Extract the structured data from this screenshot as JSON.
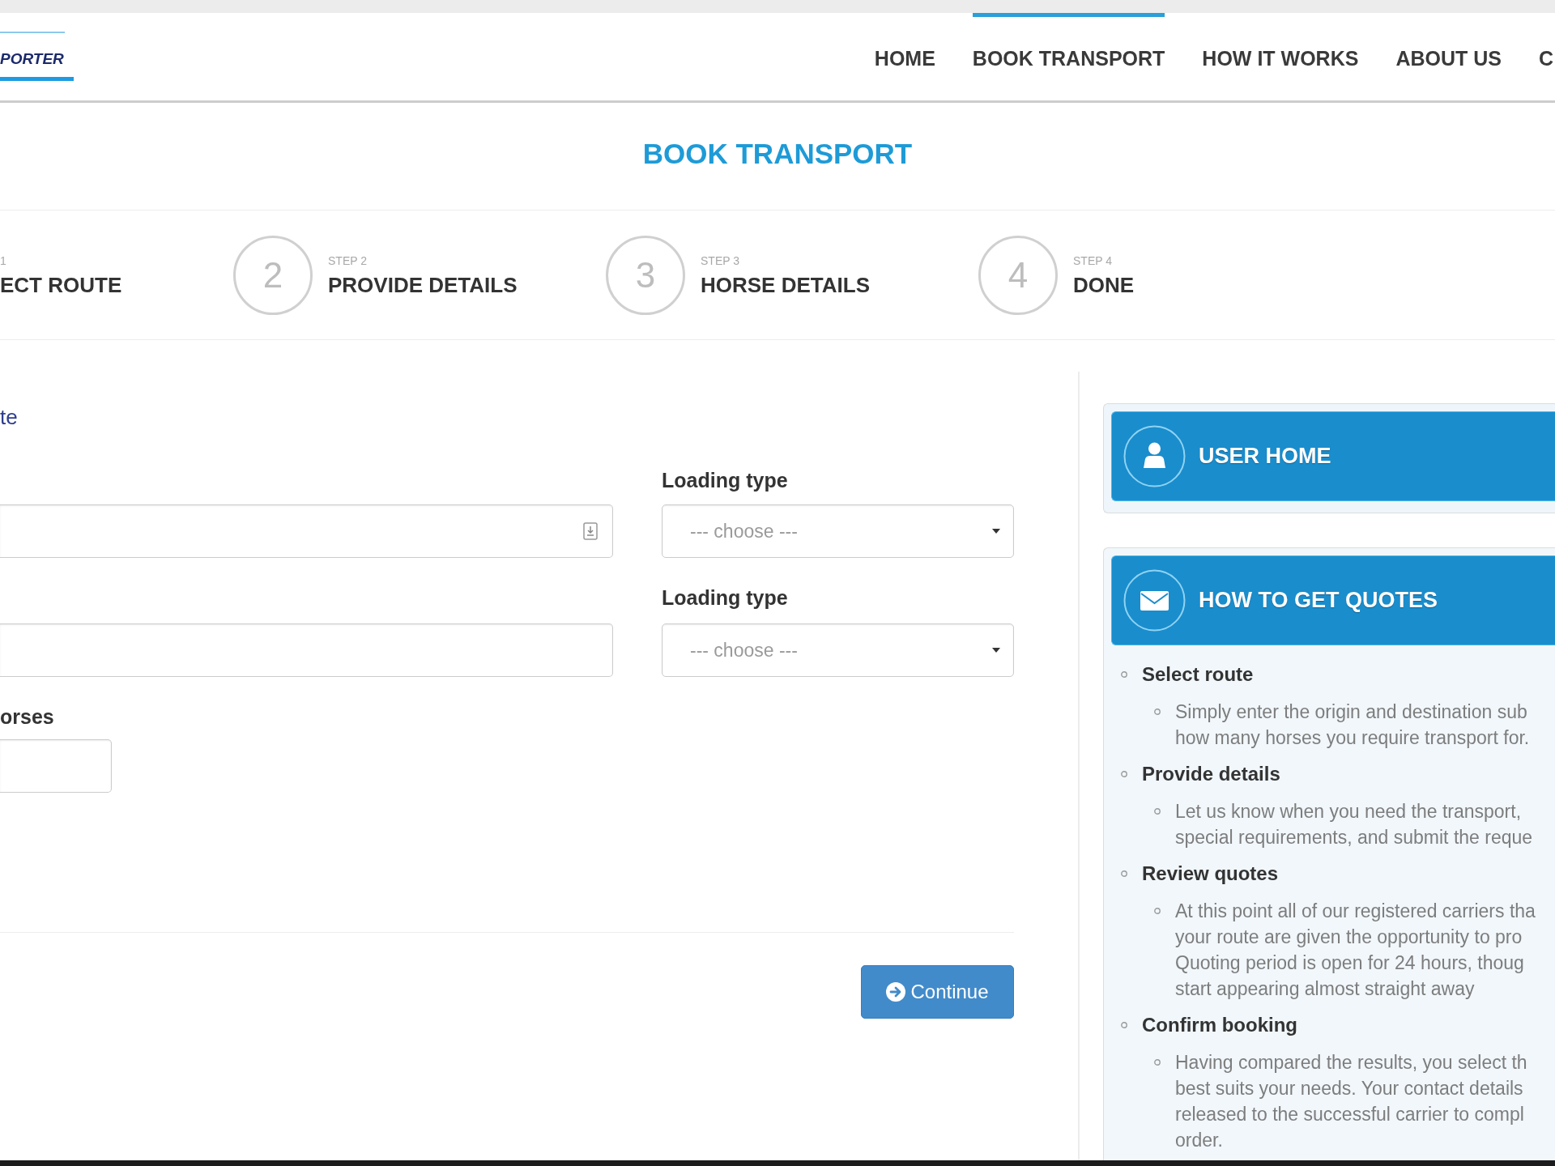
{
  "header": {
    "logo": {
      "text": "PORTER"
    },
    "nav": [
      {
        "label": "HOME",
        "selected": false
      },
      {
        "label": "BOOK TRANSPORT",
        "selected": true
      },
      {
        "label": "HOW IT WORKS",
        "selected": false
      },
      {
        "label": "ABOUT US",
        "selected": false
      },
      {
        "label": "C",
        "selected": false
      }
    ]
  },
  "page_title": "BOOK TRANSPORT",
  "steps": [
    {
      "label": "1",
      "title": "ECT ROUTE"
    },
    {
      "number": "2",
      "label": "STEP 2",
      "title": "PROVIDE DETAILS"
    },
    {
      "number": "3",
      "label": "STEP 3",
      "title": "HORSE DETAILS"
    },
    {
      "number": "4",
      "label": "STEP 4",
      "title": "DONE"
    }
  ],
  "form": {
    "heading": "te",
    "rows": [
      {
        "picker_icon": true,
        "select": {
          "label": "Loading type",
          "placeholder": "--- choose ---"
        }
      },
      {
        "picker_icon": false,
        "select": {
          "label": "Loading type",
          "placeholder": "--- choose ---"
        }
      }
    ],
    "horses": {
      "label": "orses"
    },
    "continue_button": {
      "label": "Continue"
    }
  },
  "sidebar": {
    "user_home": {
      "title": "USER HOME"
    },
    "quotes": {
      "title": "HOW TO GET QUOTES",
      "items": [
        {
          "title": "Select route",
          "children": [
            {
              "lines": [
                "Simply enter the origin and destination sub",
                "how many horses you require transport for."
              ]
            }
          ]
        },
        {
          "title": "Provide details",
          "children": [
            {
              "lines": [
                "Let us know when you need the transport,",
                "special requirements, and submit the reque"
              ]
            }
          ]
        },
        {
          "title": "Review quotes",
          "children": [
            {
              "lines": [
                "At this point all of our registered carriers tha",
                "your route are given the opportunity to pro",
                "Quoting period is open for 24 hours, thoug",
                "start appearing almost straight away"
              ]
            }
          ]
        },
        {
          "title": "Confirm booking",
          "children": [
            {
              "lines": [
                "Having compared the results, you select th",
                "best suits your needs. Your contact details",
                "released to the successful carrier to compl",
                "order."
              ]
            }
          ]
        }
      ]
    }
  }
}
